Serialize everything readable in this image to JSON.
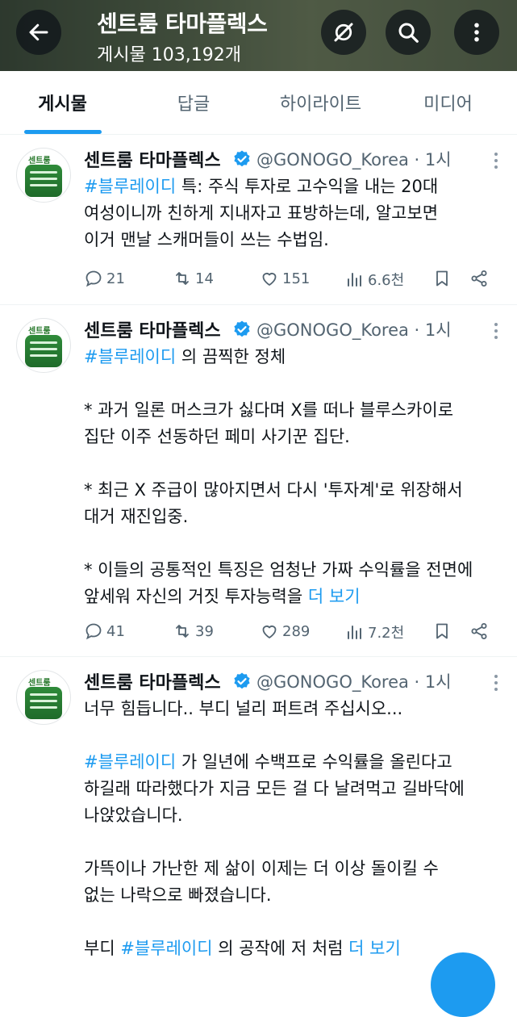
{
  "header": {
    "title": "센트룸 타마플렉스",
    "post_count": "게시물 103,192개"
  },
  "tabs": [
    "게시물",
    "답글",
    "하이라이트",
    "미디어"
  ],
  "posts": [
    {
      "name": "센트룸 타마플렉스",
      "handle": "@GONOGO_Korea · 1시",
      "lines": [
        {
          "tag": "#블루레이디",
          "text": " 특:  주식 투자로 고수익을 내는 20대"
        },
        {
          "text": "여성이니까 친하게 지내자고 표방하는데, 알고보면"
        },
        {
          "text": "이거 맨날 스캐머들이 쓰는 수법임."
        }
      ],
      "stats": {
        "replies": "21",
        "reposts": "14",
        "likes": "151",
        "views": "6.6천"
      }
    },
    {
      "name": "센트룸 타마플렉스",
      "handle": "@GONOGO_Korea · 1시",
      "lines": [
        {
          "tag": "#블루레이디",
          "text": " 의 끔찍한 정체"
        },
        {
          "text": ""
        },
        {
          "text": "* 과거 일론 머스크가 싫다며 X를 떠나 블루스카이로"
        },
        {
          "text": "집단 이주 선동하던 페미 사기꾼 집단."
        },
        {
          "text": ""
        },
        {
          "text": "* 최근 X 주급이 많아지면서 다시 '투자계'로 위장해서"
        },
        {
          "text": "대거 재진입중."
        },
        {
          "text": ""
        },
        {
          "text": "* 이들의 공통적인 특징은 엄청난 가짜 수익률을 전면에"
        },
        {
          "text": "앞세워 자신의 거짓 투자능력을 ",
          "more": "더 보기"
        }
      ],
      "stats": {
        "replies": "41",
        "reposts": "39",
        "likes": "289",
        "views": "7.2천"
      }
    },
    {
      "name": "센트룸 타마플렉스",
      "handle": "@GONOGO_Korea · 1시",
      "lines": [
        {
          "text": "너무 힘듭니다.. 부디 널리 퍼트려 주십시오..."
        },
        {
          "text": ""
        },
        {
          "tag": "#블루레이디",
          "text": " 가 일년에 수백프로 수익률을 올린다고"
        },
        {
          "text": "하길래 따라했다가 지금 모든 걸 다 날려먹고 길바닥에"
        },
        {
          "text": "나앉았습니다."
        },
        {
          "text": ""
        },
        {
          "text": "가뜩이나 가난한 제 삶이 이제는 더 이상 돌이킬 수"
        },
        {
          "text": "없는 나락으로 빠졌습니다."
        },
        {
          "text": ""
        },
        {
          "prefix": "부디 ",
          "tag": "#블루레이디",
          "text": " 의 공작에 저 처럼 ",
          "more": "더 보기"
        }
      ]
    }
  ],
  "colors": {
    "accent": "#1d9bf0",
    "muted": "#536471",
    "text": "#0f1419"
  }
}
